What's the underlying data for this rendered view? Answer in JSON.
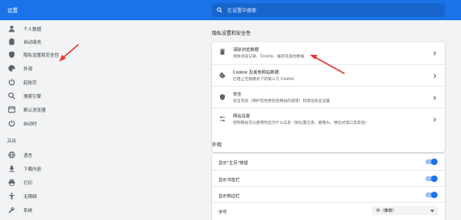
{
  "header": {
    "title": "设置",
    "search_placeholder": "在设置中搜索"
  },
  "sidebar": {
    "items": [
      {
        "label": "个人数据",
        "icon": "person-icon"
      },
      {
        "label": "自动填充",
        "icon": "clipboard-icon"
      },
      {
        "label": "隐私设置和安全性",
        "icon": "shield-icon"
      },
      {
        "label": "外观",
        "icon": "palette-icon"
      },
      {
        "label": "起始页",
        "icon": "power-icon"
      },
      {
        "label": "搜索引擎",
        "icon": "search-icon"
      },
      {
        "label": "默认浏览器",
        "icon": "browser-icon"
      },
      {
        "label": "启动时",
        "icon": "power-icon"
      }
    ],
    "advanced_label": "高级",
    "advanced_items": [
      {
        "label": "语言",
        "icon": "globe-icon"
      },
      {
        "label": "下载内容",
        "icon": "download-icon"
      },
      {
        "label": "打印",
        "icon": "printer-icon"
      },
      {
        "label": "无障碍",
        "icon": "accessibility-icon"
      },
      {
        "label": "系统",
        "icon": "wrench-icon"
      }
    ]
  },
  "privacy": {
    "title": "隐私设置和安全性",
    "rows": [
      {
        "title": "清除浏览数据",
        "subtitle": "清除浏览记录、Cookie、缓存及其他数据",
        "icon": "trash-icon"
      },
      {
        "title": "Cookie 及其他网站数据",
        "subtitle": "已阻止无痕模式下的第三方 Cookie",
        "icon": "cookie-icon"
      },
      {
        "title": "安全",
        "subtitle": "安全浏览（保护您免受危险网站的侵害）和其他安全设置",
        "icon": "shield-icon"
      },
      {
        "title": "网站设置",
        "subtitle": "控制网站可以使用和显示什么信息（如位置信息、摄像头、弹出式窗口及其他）",
        "icon": "sliders-icon"
      }
    ]
  },
  "appearance": {
    "title": "外观",
    "rows": [
      {
        "label": "显示\"主页\"按钮",
        "enabled": true
      },
      {
        "label": "显示书签栏",
        "enabled": true
      },
      {
        "label": "显示侧边栏",
        "enabled": true
      }
    ],
    "font_size_label": "字号",
    "font_size_value": "中（推荐）"
  },
  "colors": {
    "accent": "#1a73e8",
    "annotation": "#e53935"
  }
}
